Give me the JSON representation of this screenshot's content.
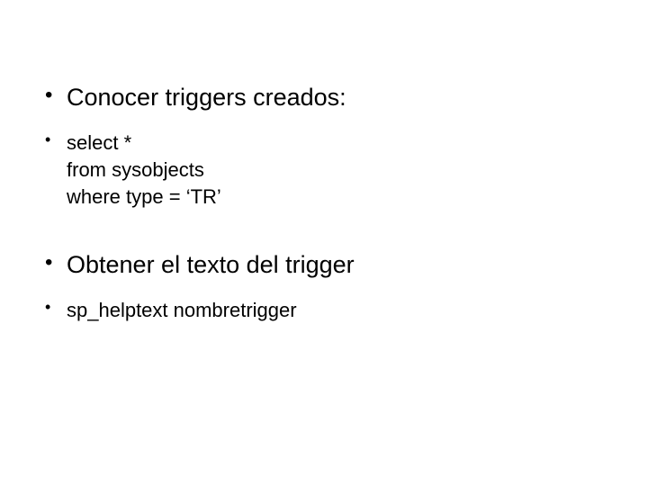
{
  "slide": {
    "items": [
      {
        "size": "large",
        "text": "Conocer triggers creados:",
        "spacerBefore": false
      },
      {
        "size": "small",
        "text": "select *\nfrom sysobjects\nwhere type = ‘TR’",
        "spacerBefore": false
      },
      {
        "size": "large",
        "text": "Obtener el texto del trigger",
        "spacerBefore": true
      },
      {
        "size": "small",
        "text": "sp_helptext nombretrigger",
        "spacerBefore": false
      }
    ],
    "bullet": "•"
  }
}
